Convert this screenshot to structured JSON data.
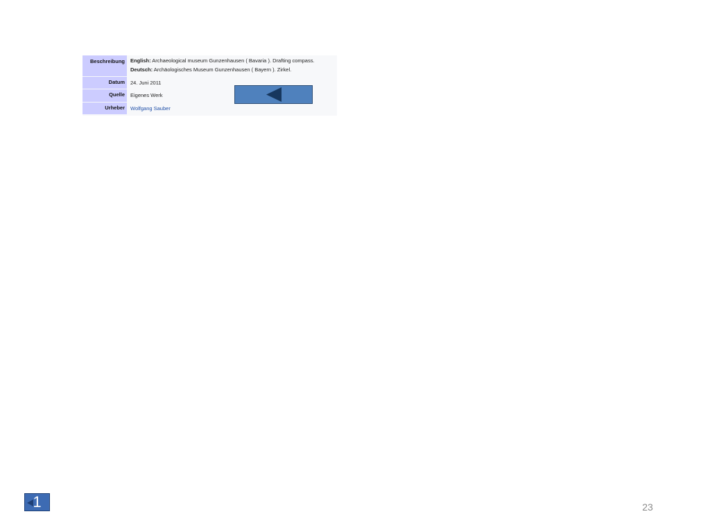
{
  "info": {
    "rows": [
      {
        "label": "Beschreibung",
        "lines": [
          {
            "lang": "English:",
            "text": " Archaeological museum Gunzenhausen ( Bavaria ). Drafting compass."
          },
          {
            "lang": "Deutsch:",
            "text": " Archäologisches Museum Gunzenhausen ( Bayern ). Zirkel."
          }
        ]
      },
      {
        "label": "Datum",
        "value": "24. Juni 2011"
      },
      {
        "label": "Quelle",
        "value": "Eigenes Werk"
      },
      {
        "label": "Urheber",
        "value": "Wolfgang Sauber"
      }
    ]
  },
  "nav": {
    "back_icon": "left-triangle-icon",
    "home_label": "1"
  },
  "footer": {
    "page_number": "23"
  },
  "colors": {
    "label_bg": "#ccccff",
    "button_blue": "#4f81bd",
    "arrow_dark": "#17375e",
    "link": "#1f4fa8"
  }
}
